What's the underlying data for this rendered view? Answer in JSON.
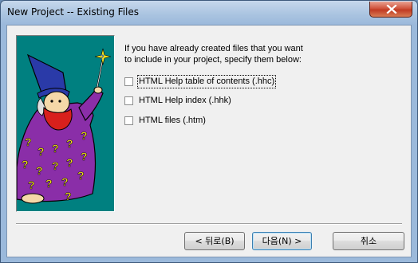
{
  "window": {
    "title": "New Project -- Existing Files"
  },
  "instructions": {
    "line1": "If you have already created files that you want",
    "line2": "to include in your project, specify them below:"
  },
  "options": [
    {
      "label": "HTML Help table of contents (.hhc)",
      "checked": false,
      "focused": true
    },
    {
      "label": "HTML Help index (.hhk)",
      "checked": false,
      "focused": false
    },
    {
      "label": "HTML files (.htm)",
      "checked": false,
      "focused": false
    }
  ],
  "buttons": {
    "back": "< 뒤로(B)",
    "next": "다음(N) >",
    "cancel": "취소"
  },
  "icons": {
    "close": "close-icon",
    "wizard": "wizard-illustration"
  },
  "colors": {
    "wizard_background": "#008080",
    "close_button": "#c13b23"
  }
}
